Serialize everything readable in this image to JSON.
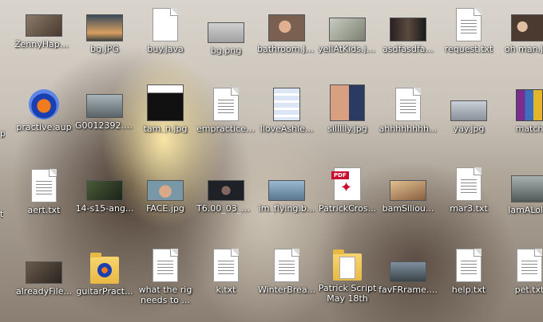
{
  "desktop": {
    "icons": [
      {
        "label": "ZennyHapp...",
        "kind": "image",
        "color": "#6a5a4a"
      },
      {
        "label": "bg.JPG",
        "kind": "image",
        "color": "#5a6a7a"
      },
      {
        "label": "buy.java",
        "kind": "doc-blank"
      },
      {
        "label": "bg.png",
        "kind": "image",
        "color": "#b8b8b8"
      },
      {
        "label": "bathroom.JPG",
        "kind": "image",
        "color": "#8a7060"
      },
      {
        "label": "yellAtKids.jpg",
        "kind": "image",
        "color": "#9aa08a"
      },
      {
        "label": "asdfasdfa...",
        "kind": "image",
        "color": "#3a3030"
      },
      {
        "label": "request.txt",
        "kind": "doc"
      },
      {
        "label": "oh man.jpg",
        "kind": "image",
        "color": "#6a5040"
      },
      {
        "label": "practive.aup",
        "kind": "audacity"
      },
      {
        "label": "G0012392.JPG",
        "kind": "image",
        "color": "#7a8a90"
      },
      {
        "label": "tam_n.jpg",
        "kind": "image",
        "color": "#202020"
      },
      {
        "label": "empractice....",
        "kind": "doc"
      },
      {
        "label": "IloveAshle...",
        "kind": "image",
        "color": "#dde6f2"
      },
      {
        "label": "sillllly.jpg",
        "kind": "image",
        "color": "#b07a5a"
      },
      {
        "label": "ahhhhhhhh...",
        "kind": "doc"
      },
      {
        "label": "yay.jpg",
        "kind": "image",
        "color": "#a8b0b8"
      },
      {
        "label": "match",
        "kind": "rar"
      },
      {
        "label": "aert.txt",
        "kind": "doc"
      },
      {
        "label": "14-s15-ang...",
        "kind": "image",
        "color": "#3a4a30"
      },
      {
        "label": "FACE.jpg",
        "kind": "image",
        "color": "#6a8090"
      },
      {
        "label": "T6.00_03_04...",
        "kind": "image",
        "color": "#202428"
      },
      {
        "label": "im_flying.b...",
        "kind": "image",
        "color": "#8aa8c0"
      },
      {
        "label": "PatrickCros...",
        "kind": "pdf",
        "tag": "PDF"
      },
      {
        "label": "bamSiliou...",
        "kind": "image",
        "color": "#c09060"
      },
      {
        "label": "mar3.txt",
        "kind": "doc"
      },
      {
        "label": "IamALolle",
        "kind": "image",
        "color": "#707878"
      },
      {
        "label": "alreadyFile...",
        "kind": "image",
        "color": "#4a4038"
      },
      {
        "label": "guitarPract...",
        "kind": "folder-audacity"
      },
      {
        "label": "what the rig needs to ...",
        "kind": "doc"
      },
      {
        "label": "k.txt",
        "kind": "doc"
      },
      {
        "label": "WinterBrea...",
        "kind": "doc"
      },
      {
        "label": "Patrick Script May 18th",
        "kind": "folder-doc"
      },
      {
        "label": "favFRrame....",
        "kind": "image",
        "color": "#5a6a70"
      },
      {
        "label": "help.txt",
        "kind": "doc"
      },
      {
        "label": "pet.txt",
        "kind": "doc"
      }
    ]
  },
  "edge": {
    "left_label_row2": "p",
    "left_label_row3": "t"
  }
}
